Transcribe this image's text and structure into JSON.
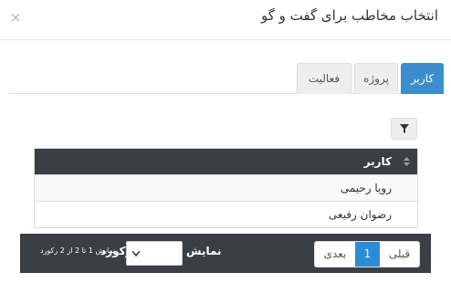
{
  "modal": {
    "title": "انتخاب مخاطب برای گفت و گو",
    "close_glyph": "×"
  },
  "tabs": [
    {
      "label": "کاربر",
      "active": true
    },
    {
      "label": "پروژه",
      "active": false
    },
    {
      "label": "فعالیت",
      "active": false
    }
  ],
  "grid": {
    "column_header": "کاربر",
    "rows": [
      "رویا رحیمی",
      "رضوان رفیعی"
    ]
  },
  "footer": {
    "pager": {
      "prev_label": "قبلی",
      "page_label": "1",
      "next_label": "بعدی"
    },
    "show_label": "نمایش",
    "records_label": "رکورد",
    "records_info": "نمایش 1 تا 2 از 2 رکورد"
  },
  "icons": {
    "filter": "filter-icon",
    "sort": "sort-icon",
    "select_arrow": "chevron-down-icon"
  },
  "colors": {
    "accent": "#3c8dcc",
    "page_active": "#2e8bd6",
    "dark_bar": "#3a3f45"
  }
}
